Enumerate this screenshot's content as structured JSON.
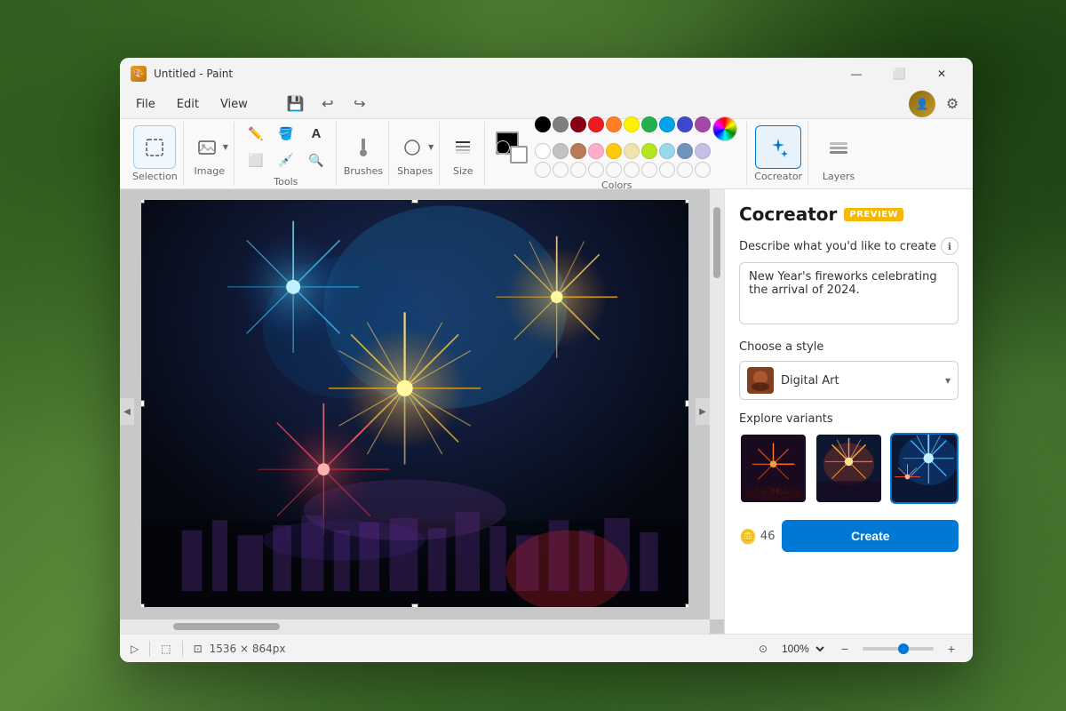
{
  "app": {
    "title": "Untitled - Paint",
    "icon_label": "paint-icon"
  },
  "window_controls": {
    "minimize": "—",
    "maximize": "⬜",
    "close": "✕"
  },
  "menu": {
    "file": "File",
    "edit": "Edit",
    "view": "View",
    "save_icon": "💾",
    "undo_icon": "↩",
    "redo_icon": "↪"
  },
  "toolbar": {
    "selection_label": "Selection",
    "image_label": "Image",
    "tools_label": "Tools",
    "brushes_label": "Brushes",
    "shapes_label": "Shapes",
    "size_label": "Size",
    "colors_label": "Colors",
    "cocreator_label": "Cocreator",
    "layers_label": "Layers"
  },
  "colors": {
    "row1": [
      "#000000",
      "#7f7f7f",
      "#880015",
      "#ed1c24",
      "#ff7f27",
      "#fff200",
      "#22b14c",
      "#00a2e8",
      "#3f48cc",
      "#a349a4"
    ],
    "row2": [
      "#ffffff",
      "#c3c3c3",
      "#b97a57",
      "#ffaec9",
      "#ffc90e",
      "#efe4b0",
      "#b5e61d",
      "#99d9ea",
      "#7092be",
      "#c8bfe7"
    ],
    "row3": [
      "transparent",
      "transparent",
      "transparent",
      "transparent",
      "transparent",
      "transparent",
      "transparent",
      "transparent",
      "transparent",
      "transparent"
    ],
    "row4": [
      "transparent",
      "transparent",
      "transparent",
      "transparent",
      "transparent",
      "transparent",
      "transparent",
      "transparent",
      "transparent",
      "transparent"
    ]
  },
  "status_bar": {
    "dimensions": "1536 × 864px",
    "zoom_value": "100%",
    "zoom_percent": 100
  },
  "cocreator_panel": {
    "title": "Cocreator",
    "badge": "PREVIEW",
    "describe_label": "Describe what you'd like to create",
    "prompt_text": "New Year's fireworks celebrating the arrival of 2024.",
    "style_label": "Choose a style",
    "style_name": "Digital Art",
    "variants_label": "Explore variants",
    "credits": "46",
    "create_btn": "Create"
  }
}
